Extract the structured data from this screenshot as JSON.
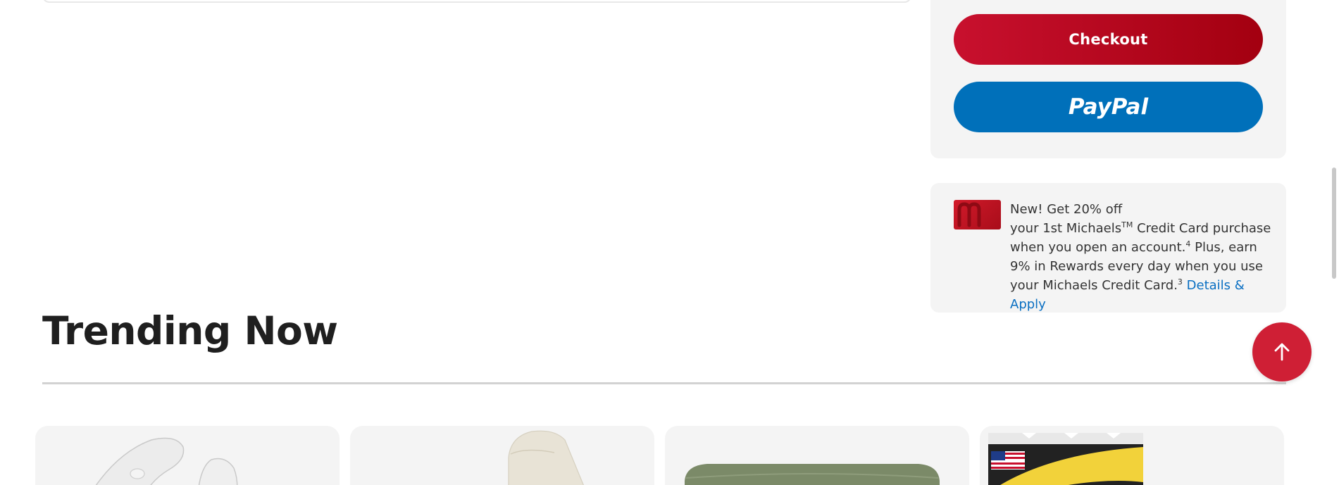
{
  "summary": {
    "checkout_label": "Checkout",
    "paypal_label": "PayPal"
  },
  "promo": {
    "line1": "New! Get 20% off",
    "line2a": "your 1st Michaels",
    "tm": "TM",
    "line2b": " Credit Card purchase when you open an account.",
    "sup4": "4",
    "line3": " Plus, earn 9% in Rewards every day when you use your Michaels Credit Card.",
    "sup3": "3",
    "link": "Details & Apply",
    "card_icon": "michaels-credit-card-icon"
  },
  "trending": {
    "title": "Trending Now"
  },
  "back_to_top": {
    "icon": "arrow-up-icon"
  },
  "colors": {
    "checkout": "#c8102e",
    "paypal": "#0070ba",
    "link": "#0a6fc2",
    "back_to_top": "#cf1f35"
  }
}
